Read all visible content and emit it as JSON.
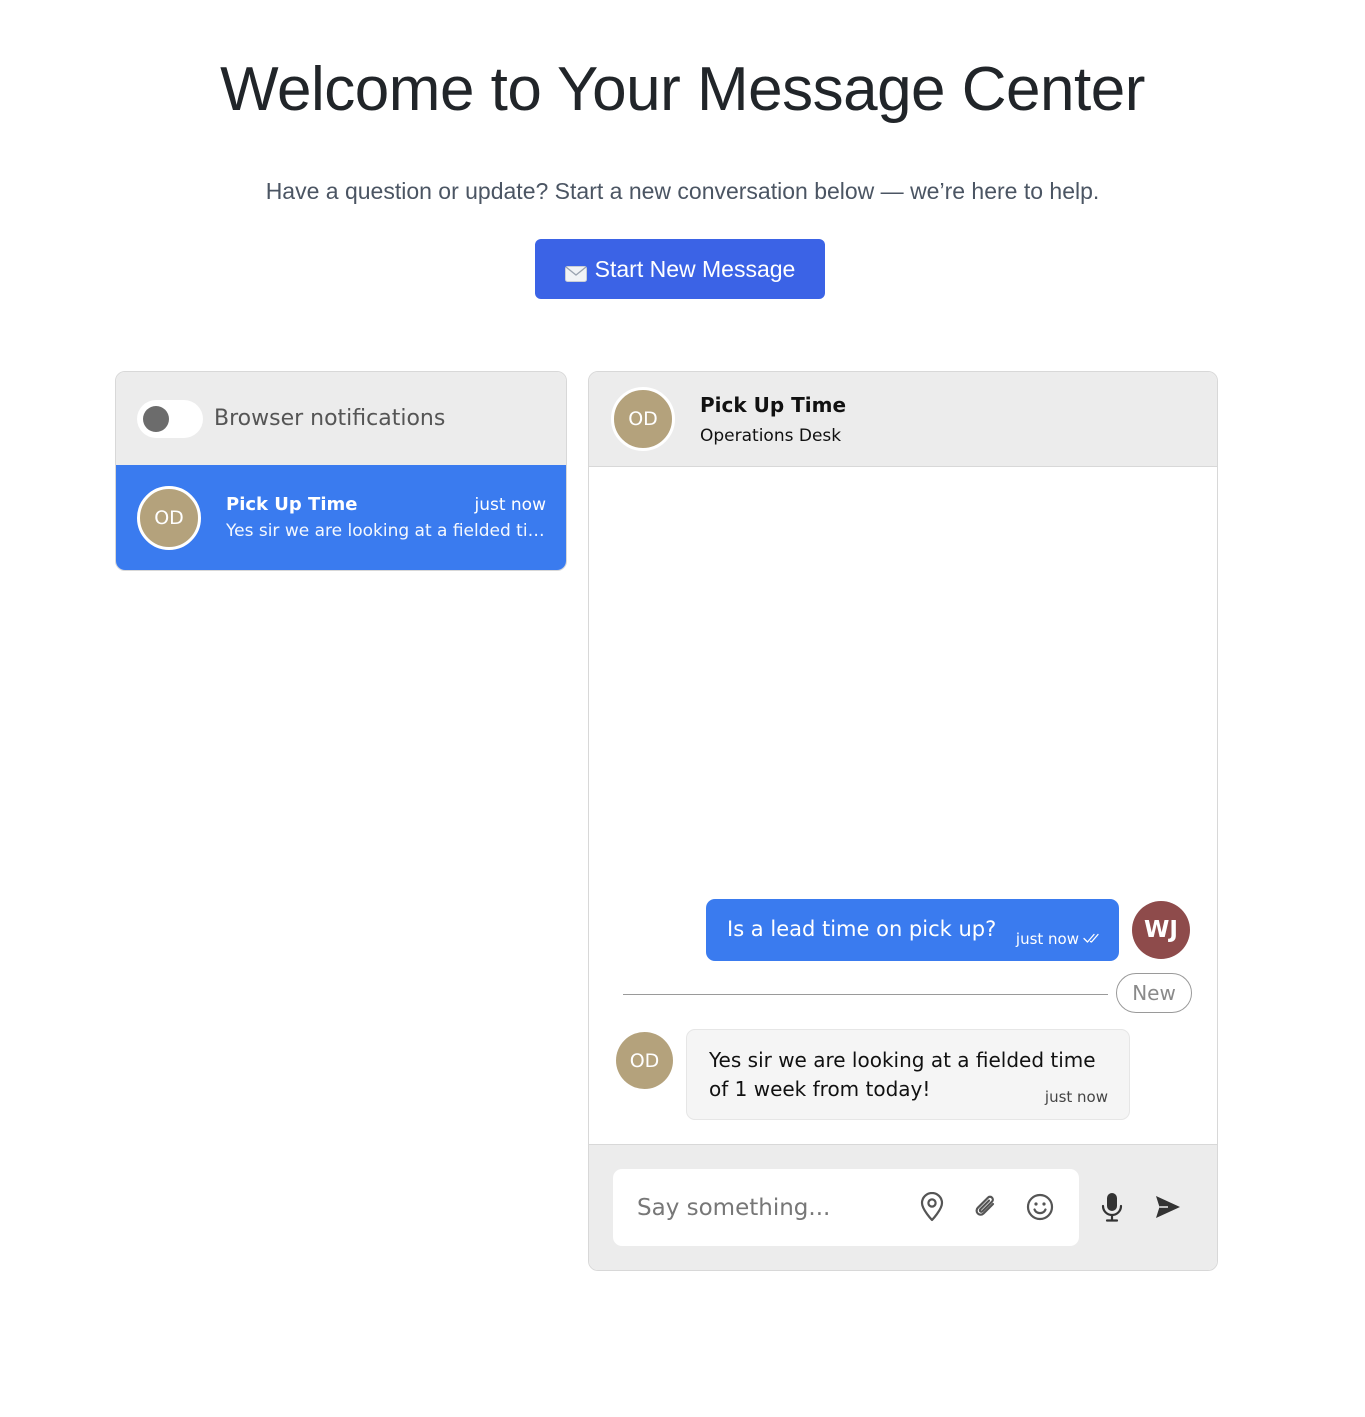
{
  "header": {
    "title": "Welcome to Your Message Center",
    "subtitle": "Have a question or update? Start a new conversation below — we’re here to help.",
    "start_button_label": "Start New Message"
  },
  "sidebar": {
    "notifications_label": "Browser notifications",
    "notifications_enabled": false,
    "conversations": [
      {
        "initials": "OD",
        "title": "Pick Up Time",
        "time": "just now",
        "preview": "Yes sir we are looking at a fielded time of 1 week from today!"
      }
    ]
  },
  "chat": {
    "avatar_initials": "OD",
    "title": "Pick Up Time",
    "subtitle": "Operations Desk",
    "messages": [
      {
        "direction": "outgoing",
        "text": "Is a lead time on pick up?",
        "time": "just now",
        "avatar_initials": "WJ"
      },
      {
        "direction": "incoming",
        "text": "Yes sir we are looking at a fielded time of 1 week from today!",
        "time": "just now",
        "avatar_initials": "OD"
      }
    ],
    "new_divider_label": "New",
    "composer": {
      "placeholder": "Say something...",
      "icons": [
        "location-pin-icon",
        "paperclip-icon",
        "emoji-icon",
        "microphone-icon",
        "send-icon"
      ]
    }
  },
  "colors": {
    "primary_button": "#3b63e6",
    "selected_conversation": "#3a7bef",
    "outgoing_bubble": "#3a7bef",
    "od_avatar": "#b4a27c",
    "wj_avatar": "#8e4b4b"
  }
}
